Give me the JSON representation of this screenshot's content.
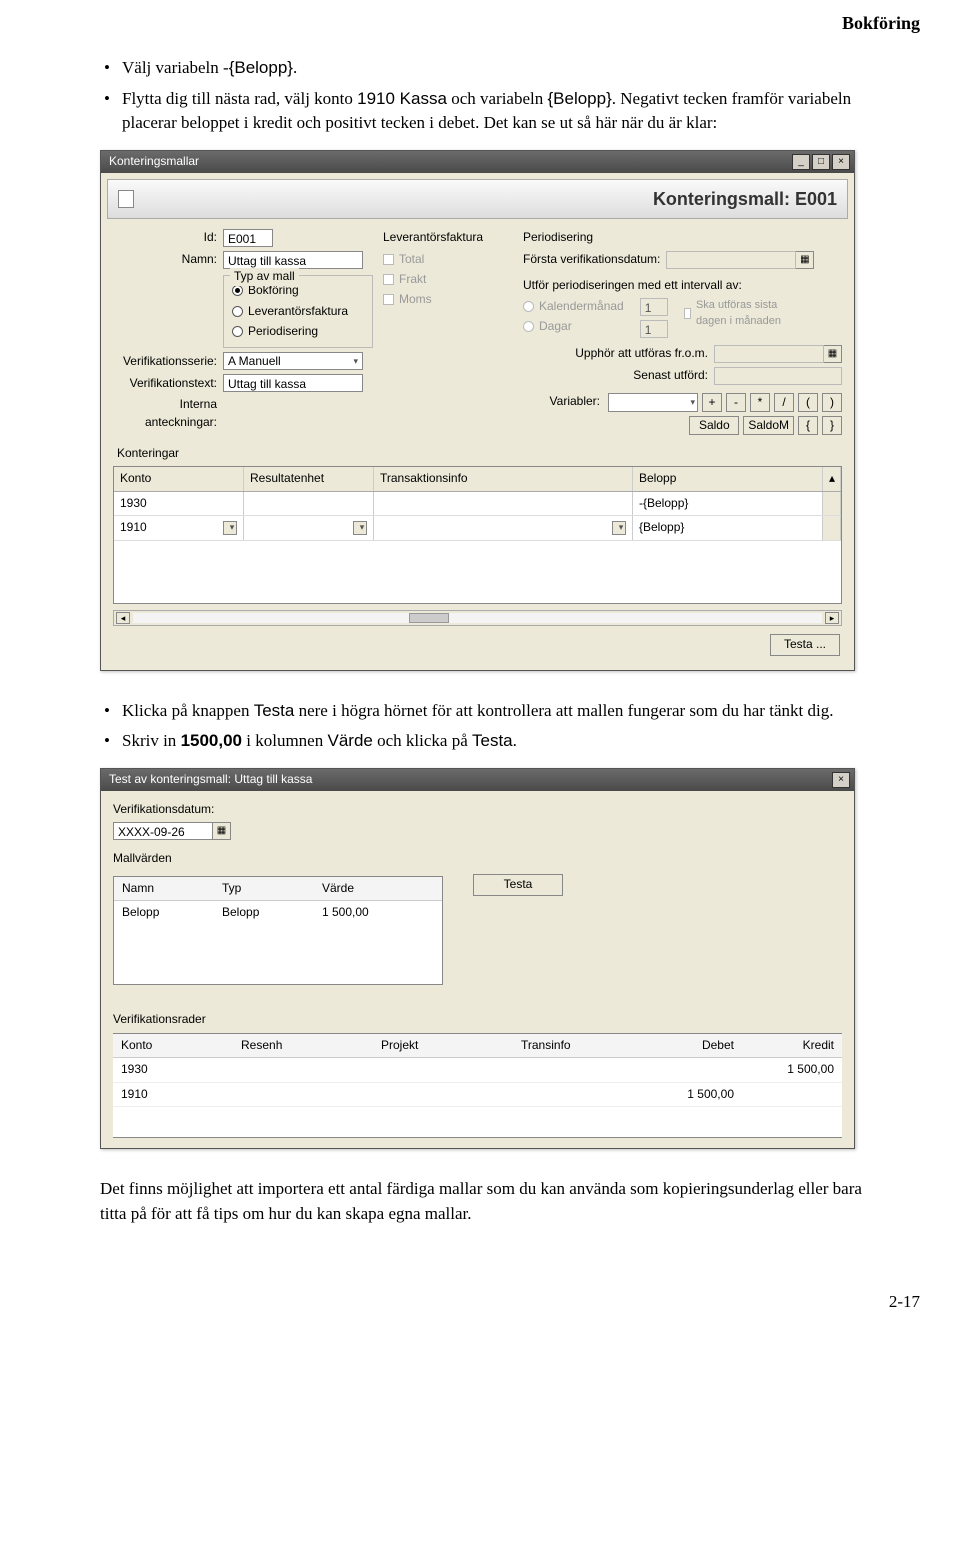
{
  "header": "Bokföring",
  "bullets_top": [
    {
      "pre": "Välj variabeln -",
      "var": "{Belopp}",
      "post": "."
    },
    {
      "pre": "Flytta dig till nästa rad, välj konto ",
      "sans1": "1910 Kassa",
      "mid": " och variabeln ",
      "sans2": "{Belopp}",
      "post": ". Negativt tecken framför variabeln placerar beloppet i kredit och positivt tecken i debet. Det kan se ut så här när du är klar:"
    }
  ],
  "bullets_mid": [
    {
      "pre": "Klicka på knappen ",
      "sans1": "Testa",
      "post": " nere i högra hörnet för att kontrollera att mallen fungerar som du har tänkt dig."
    },
    {
      "pre": "Skriv in ",
      "bold1": "1500,00",
      "mid1": " i kolumnen ",
      "sans1": "Värde",
      "mid2": " och klicka på ",
      "sans2": "Testa",
      "post": "."
    }
  ],
  "para_end": "Det finns möjlighet att importera ett antal färdiga mallar som du kan använda som kopieringsunderlag eller bara titta på för att få tips om hur du kan skapa egna mallar.",
  "page_num": "2-17",
  "win1": {
    "title": "Konteringsmallar",
    "doc_title": "Konteringsmall: E001",
    "labels": {
      "id": "Id:",
      "namn": "Namn:",
      "typ": "Typ av mall",
      "verserie": "Verifikationsserie:",
      "vertext": "Verifikationstext:",
      "intern": "Interna anteckningar:",
      "levfak": "Leverantörsfaktura",
      "period": "Periodisering",
      "forstaver": "Första verifikationsdatum:",
      "utfor": "Utför periodiseringen med ett intervall av:",
      "upphor": "Upphör att utföras fr.o.m.",
      "senast": "Senast utförd:",
      "variabler": "Variabler:",
      "konteringar": "Konteringar"
    },
    "values": {
      "id": "E001",
      "namn": "Uttag till kassa",
      "verserie": "A  Manuell",
      "vertext": "Uttag till kassa",
      "kalender_val": "1",
      "dagar_val": "1"
    },
    "radios": {
      "bokforing": "Bokföring",
      "levfaktura": "Leverantörsfaktura",
      "periodisering": "Periodisering",
      "kalender": "Kalendermånad",
      "dagar": "Dagar"
    },
    "chk": {
      "total": "Total",
      "frakt": "Frakt",
      "moms": "Moms",
      "ska": "Ska utföras sista dagen i månaden"
    },
    "varbtns": {
      "plus": "+",
      "minus": "-",
      "mul": "*",
      "div": "/",
      "lp": "(",
      "rp": ")",
      "saldo": "Saldo",
      "saldom": "SaldoM",
      "lb": "{",
      "rb": "}"
    },
    "grid": {
      "headers": {
        "konto": "Konto",
        "res": "Resultatenhet",
        "trans": "Transaktionsinfo",
        "belopp": "Belopp"
      },
      "rows": [
        {
          "konto": "1930",
          "belopp": "-{Belopp}"
        },
        {
          "konto": "1910",
          "belopp": "{Belopp}"
        }
      ]
    },
    "testa_btn": "Testa ..."
  },
  "win2": {
    "title": "Test av konteringsmall: Uttag till kassa",
    "labels": {
      "verdat": "Verifikationsdatum:",
      "mallvarden": "Mallvärden",
      "verrader": "Verifikationsrader"
    },
    "values": {
      "verdat": "XXXX-09-26"
    },
    "mallgrid": {
      "headers": {
        "namn": "Namn",
        "typ": "Typ",
        "varde": "Värde"
      },
      "row": {
        "namn": "Belopp",
        "typ": "Belopp",
        "varde": "1 500,00"
      }
    },
    "testa_btn": "Testa",
    "vergrid": {
      "headers": {
        "konto": "Konto",
        "res": "Resenh",
        "proj": "Projekt",
        "trans": "Transinfo",
        "debet": "Debet",
        "kredit": "Kredit"
      },
      "rows": [
        {
          "konto": "1930",
          "debet": "",
          "kredit": "1 500,00"
        },
        {
          "konto": "1910",
          "debet": "1 500,00",
          "kredit": ""
        }
      ]
    }
  }
}
